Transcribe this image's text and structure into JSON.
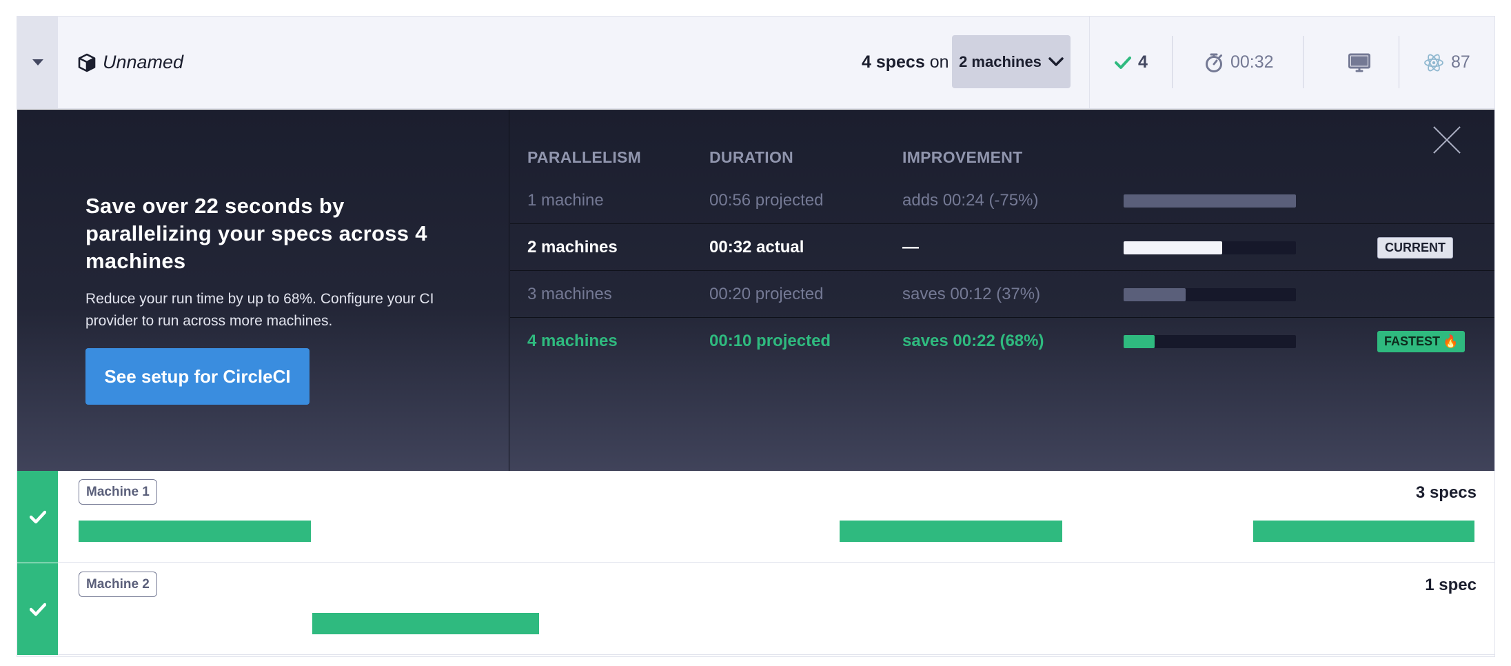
{
  "header": {
    "run_name": "Unnamed",
    "specs_count": "4 specs",
    "specs_on": "on",
    "machines_selected": "2 machines",
    "passed": "4",
    "duration": "00:32",
    "flaky": "87",
    "icons": {
      "collapse": "caret-down-icon",
      "run": "cube-icon",
      "dropdown": "chevron-down-icon",
      "passed": "check-icon",
      "duration": "stopwatch-icon",
      "os": "monitor-icon",
      "browser": "electron-icon"
    }
  },
  "promo": {
    "heading": "Save over 22 seconds by parallelizing your specs across 4 machines",
    "body": "Reduce your run time by up to 68%. Configure your CI provider to run across more machines.",
    "cta": "See setup for CircleCI",
    "columns": [
      "PARALLELISM",
      "DURATION",
      "IMPROVEMENT"
    ],
    "rows": [
      {
        "machines": "1 machine",
        "duration": "00:56 projected",
        "improvement": "adds 00:24 (-75%)",
        "bar_fraction": 1.0,
        "badge": ""
      },
      {
        "machines": "2 machines",
        "duration": "00:32 actual",
        "improvement": "—",
        "bar_fraction": 0.57,
        "badge": "CURRENT"
      },
      {
        "machines": "3 machines",
        "duration": "00:20 projected",
        "improvement": "saves 00:12 (37%)",
        "bar_fraction": 0.36,
        "badge": ""
      },
      {
        "machines": "4 machines",
        "duration": "00:10 projected",
        "improvement": "saves 00:22 (68%)",
        "bar_fraction": 0.18,
        "badge": "FASTEST",
        "badge_emoji": "🔥"
      }
    ]
  },
  "machines": [
    {
      "label": "Machine 1",
      "count": "3 specs",
      "status": "passed"
    },
    {
      "label": "Machine 2",
      "count": "1 spec",
      "status": "passed"
    }
  ],
  "colors": {
    "accent_green": "#2fba7f",
    "accent_blue": "#3a8ddf",
    "panel_dark": "#1b1e2e",
    "current_bar": "#f3f4fa",
    "dim_bar": "#5a5f7a"
  }
}
